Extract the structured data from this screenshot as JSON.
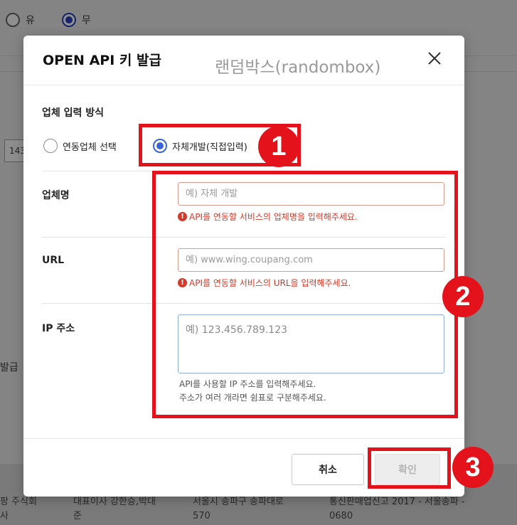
{
  "background": {
    "radio_options": [
      {
        "label": "유",
        "selected": false
      },
      {
        "label": "무",
        "selected": true
      }
    ],
    "input_partial": "143",
    "side_label": "발급",
    "footer": {
      "company": [
        "팡 주식회",
        "사"
      ],
      "ceo": [
        "대표이사 강한승,박대",
        "준"
      ],
      "address": [
        "서울시 송파구 송파대로",
        "570"
      ],
      "registration": [
        "통신판매업신고 2017 - 서울송파 -",
        "0680"
      ]
    }
  },
  "modal": {
    "title": "OPEN API 키 발급",
    "watermark": "랜덤박스(randombox)",
    "close_icon": "close-icon",
    "section_title": "업체 입력 방식",
    "input_method_options": [
      {
        "label": "연동업체 선택",
        "selected": false
      },
      {
        "label": "자체개발(직접입력)",
        "selected": true
      }
    ],
    "fields": {
      "company": {
        "label": "업체명",
        "placeholder": "예) 자체 개발",
        "error": "API를 연동할 서비스의 업체명을 입력해주세요."
      },
      "url": {
        "label": "URL",
        "placeholder": "예) www.wing.coupang.com",
        "error": "API를 연동할 서비스의 URL을 입력해주세요."
      },
      "ip": {
        "label": "IP 주소",
        "placeholder": "예) 123.456.789.123",
        "help": [
          "API를 사용할 IP 주소를 입력해주세요.",
          "주소가 여러 개라면 쉼표로 구분해주세요."
        ]
      }
    },
    "buttons": {
      "cancel": "취소",
      "confirm": "확인"
    }
  },
  "annotations": {
    "badges": [
      "1",
      "2",
      "3"
    ],
    "color": "#e3121b"
  },
  "colors": {
    "accent_blue": "#3b63d8",
    "error_red": "#d23a2a"
  }
}
